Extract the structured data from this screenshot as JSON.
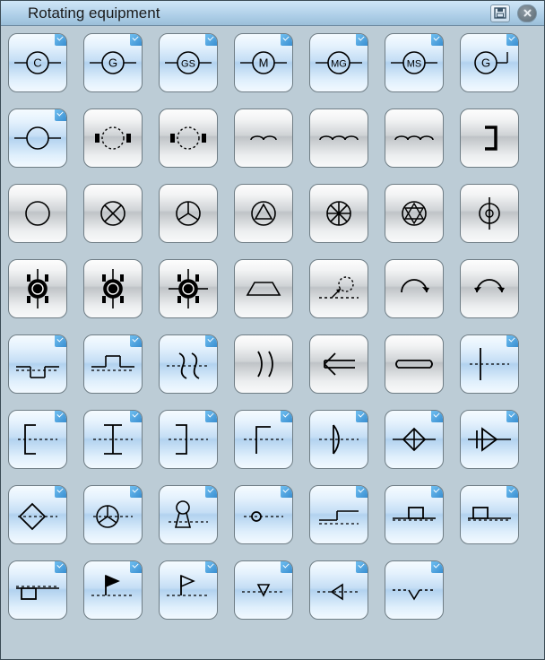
{
  "window": {
    "title": "Rotating equipment"
  },
  "titlebar_buttons": {
    "save": "save",
    "close": "close"
  },
  "palette": {
    "columns": 7,
    "stencils": [
      {
        "id": "converter-c",
        "label": "C",
        "variant": "blue",
        "checked": true,
        "glyph": "circle_letter",
        "leads": true
      },
      {
        "id": "generator-g",
        "label": "G",
        "variant": "blue",
        "checked": true,
        "glyph": "circle_letter",
        "leads": true
      },
      {
        "id": "generator-sync-gs",
        "label": "GS",
        "variant": "blue",
        "checked": true,
        "glyph": "circle_letter",
        "leads": true
      },
      {
        "id": "motor-m",
        "label": "M",
        "variant": "blue",
        "checked": true,
        "glyph": "circle_letter",
        "leads": true
      },
      {
        "id": "motor-generator-mg",
        "label": "MG",
        "variant": "blue",
        "checked": true,
        "glyph": "circle_letter",
        "leads": true
      },
      {
        "id": "motor-sync-ms",
        "label": "MS",
        "variant": "blue",
        "checked": true,
        "glyph": "circle_letter",
        "leads": true
      },
      {
        "id": "generator-g-alt",
        "label": "G",
        "variant": "blue",
        "checked": true,
        "glyph": "circle_letter_side",
        "leads": false
      },
      {
        "id": "circle-plain",
        "variant": "blue",
        "checked": true,
        "glyph": "circle_leads"
      },
      {
        "id": "dashed-blocks-1",
        "variant": "silver",
        "checked": false,
        "glyph": "dashed_circle_blocks"
      },
      {
        "id": "dashed-blocks-2",
        "variant": "silver",
        "checked": false,
        "glyph": "dashed_circle_blocks"
      },
      {
        "id": "arcs-2",
        "variant": "silver",
        "checked": false,
        "glyph": "arcs",
        "n": 2
      },
      {
        "id": "arcs-3",
        "variant": "silver",
        "checked": false,
        "glyph": "arcs",
        "n": 3
      },
      {
        "id": "arcs-3b",
        "variant": "silver",
        "checked": false,
        "glyph": "arcs",
        "n": 3
      },
      {
        "id": "bracket",
        "variant": "silver",
        "checked": false,
        "glyph": "bracket"
      },
      {
        "id": "circle",
        "variant": "silver",
        "checked": false,
        "glyph": "circle"
      },
      {
        "id": "circle-x",
        "variant": "silver",
        "checked": false,
        "glyph": "circle_x"
      },
      {
        "id": "circle-tri",
        "variant": "silver",
        "checked": false,
        "glyph": "circle_tri"
      },
      {
        "id": "circle-tri-up",
        "variant": "silver",
        "checked": false,
        "glyph": "circle_tri_up"
      },
      {
        "id": "circle-spokes",
        "variant": "silver",
        "checked": false,
        "glyph": "circle_spokes"
      },
      {
        "id": "circle-star",
        "variant": "silver",
        "checked": false,
        "glyph": "circle_star"
      },
      {
        "id": "circle-thru",
        "variant": "silver",
        "checked": false,
        "glyph": "circle_thru"
      },
      {
        "id": "wound-1",
        "variant": "silver",
        "checked": false,
        "glyph": "wound_circle",
        "brushes": 2
      },
      {
        "id": "wound-2",
        "variant": "silver",
        "checked": false,
        "glyph": "wound_circle",
        "brushes": 2
      },
      {
        "id": "wound-3",
        "variant": "silver",
        "checked": false,
        "glyph": "wound_circle",
        "brushes": 4
      },
      {
        "id": "trapezoid",
        "variant": "silver",
        "checked": false,
        "glyph": "trapezoid"
      },
      {
        "id": "dashed-arrow-circle",
        "variant": "silver",
        "checked": false,
        "glyph": "dashed_arrow"
      },
      {
        "id": "arc-arrow",
        "variant": "silver",
        "checked": false,
        "glyph": "arc_arrow",
        "n": 1
      },
      {
        "id": "arc-two-arrows",
        "variant": "silver",
        "checked": false,
        "glyph": "arc_arrow",
        "n": 2
      },
      {
        "id": "notch-up",
        "variant": "blue",
        "checked": true,
        "glyph": "notch",
        "dir": "up"
      },
      {
        "id": "notch-down",
        "variant": "blue",
        "checked": true,
        "glyph": "notch",
        "dir": "down"
      },
      {
        "id": "curly-pair-dash",
        "variant": "blue",
        "checked": true,
        "glyph": "curly_pair"
      },
      {
        "id": "paren-pair",
        "variant": "silver",
        "checked": false,
        "glyph": "paren_pair"
      },
      {
        "id": "arrow-left-bar",
        "variant": "silver",
        "checked": false,
        "glyph": "arrow_eq_left"
      },
      {
        "id": "eq-bars",
        "variant": "silver",
        "checked": false,
        "glyph": "eq_bars"
      },
      {
        "id": "t-dash",
        "variant": "blue",
        "checked": true,
        "glyph": "t_dash"
      },
      {
        "id": "bracket-open",
        "variant": "blue",
        "checked": true,
        "glyph": "bracket_open"
      },
      {
        "id": "i-beam",
        "variant": "blue",
        "checked": true,
        "glyph": "i_beam"
      },
      {
        "id": "bracket-close",
        "variant": "blue",
        "checked": true,
        "glyph": "bracket_close"
      },
      {
        "id": "l-step",
        "variant": "blue",
        "checked": true,
        "glyph": "l_step"
      },
      {
        "id": "lens-dash",
        "variant": "blue",
        "checked": true,
        "glyph": "lens"
      },
      {
        "id": "diamond-dash",
        "variant": "blue",
        "checked": true,
        "glyph": "diamond_axis"
      },
      {
        "id": "tri-back",
        "variant": "blue",
        "checked": true,
        "glyph": "tri_back"
      },
      {
        "id": "rhombus-dash",
        "variant": "blue",
        "checked": true,
        "glyph": "rhombus_dash"
      },
      {
        "id": "wheel-dash",
        "variant": "blue",
        "checked": true,
        "glyph": "wheel_dash"
      },
      {
        "id": "keyhole-dash",
        "variant": "blue",
        "checked": true,
        "glyph": "keyhole_dash"
      },
      {
        "id": "dot-dash",
        "variant": "blue",
        "checked": true,
        "glyph": "dot_dash"
      },
      {
        "id": "step-dash",
        "variant": "blue",
        "checked": true,
        "glyph": "step_dash"
      },
      {
        "id": "block-up-dash",
        "variant": "blue",
        "checked": true,
        "glyph": "block_dash",
        "align": "center"
      },
      {
        "id": "block-left-dash",
        "variant": "blue",
        "checked": true,
        "glyph": "block_dash",
        "align": "left"
      },
      {
        "id": "block-lower-dash",
        "variant": "blue",
        "checked": true,
        "glyph": "block_low_dash"
      },
      {
        "id": "flag-tri-dash",
        "variant": "blue",
        "checked": true,
        "glyph": "flag_dash",
        "filled": true
      },
      {
        "id": "flag-tri-open-dash",
        "variant": "blue",
        "checked": true,
        "glyph": "flag_dash",
        "filled": false
      },
      {
        "id": "tri-down-dash",
        "variant": "blue",
        "checked": true,
        "glyph": "tri_dash",
        "dir": "down"
      },
      {
        "id": "tri-left-dash",
        "variant": "blue",
        "checked": true,
        "glyph": "tri_dash",
        "dir": "left"
      },
      {
        "id": "vee-dash",
        "variant": "blue",
        "checked": true,
        "glyph": "vee_dash"
      }
    ]
  }
}
